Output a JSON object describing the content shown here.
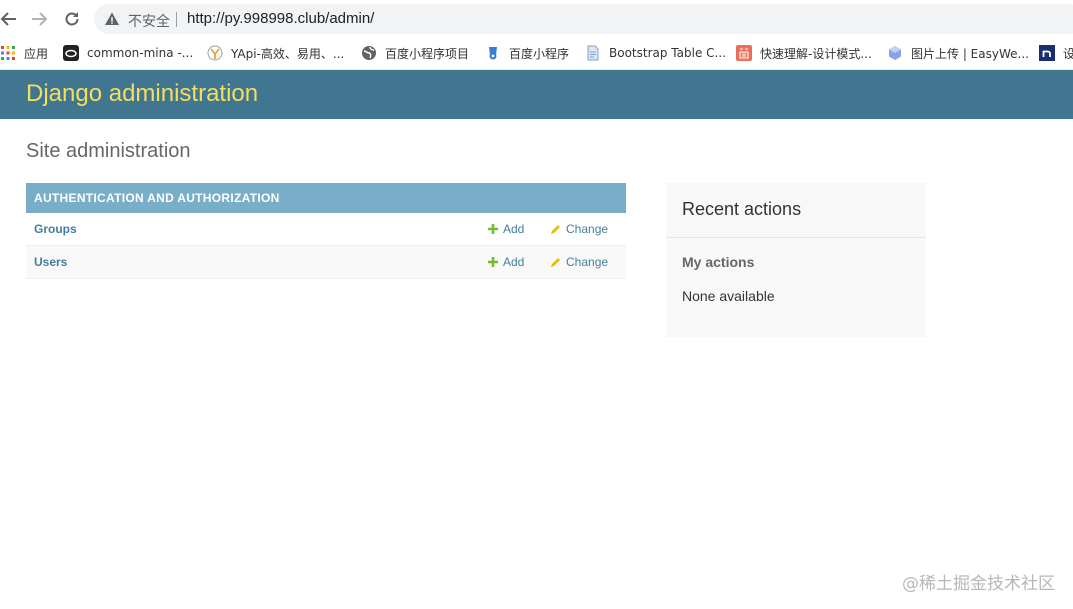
{
  "browser": {
    "address": {
      "security_label": "不安全",
      "url": "http://py.998998.club/admin/"
    },
    "bookmarks": [
      {
        "label": "应用",
        "icon": "apps-grid-icon"
      },
      {
        "label": "common-mina -...",
        "icon": "common-mina-icon"
      },
      {
        "label": "YApi-高效、易用、...",
        "icon": "yapi-icon"
      },
      {
        "label": "百度小程序项目",
        "icon": "globe-icon"
      },
      {
        "label": "百度小程序",
        "icon": "baidu-icon"
      },
      {
        "label": "Bootstrap Table C...",
        "icon": "document-icon"
      },
      {
        "label": "快速理解-设计模式...",
        "icon": "jian-icon"
      },
      {
        "label": "图片上传 | EasyWe...",
        "icon": "easyweb-icon"
      },
      {
        "label": "设",
        "icon": "n-icon"
      }
    ]
  },
  "header": {
    "brand": "Django administration"
  },
  "content": {
    "title": "Site administration",
    "app": {
      "caption": "AUTHENTICATION AND AUTHORIZATION",
      "models": [
        {
          "name": "Groups",
          "add": "Add",
          "change": "Change"
        },
        {
          "name": "Users",
          "add": "Add",
          "change": "Change"
        }
      ]
    }
  },
  "sidebar": {
    "title": "Recent actions",
    "subtitle": "My actions",
    "empty": "None available"
  },
  "watermark": "@稀土掘金技术社区",
  "colors": {
    "header_bg": "#417690",
    "brand": "#f5dd5d",
    "caption_bg": "#79aec8",
    "link": "#447e9b",
    "add_icon": "#70bf2b",
    "change_icon": "#efb80b"
  }
}
